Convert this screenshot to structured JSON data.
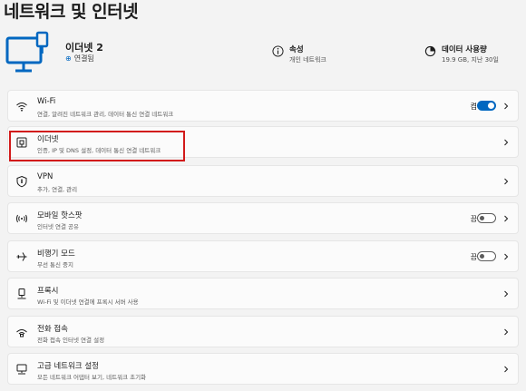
{
  "page": {
    "title": "네트워크 및 인터넷"
  },
  "device": {
    "name": "이더넷 2",
    "status": "연결됨"
  },
  "props": {
    "properties": {
      "label": "속성",
      "sub": "개인 네트워크"
    },
    "usage": {
      "label": "데이터 사용량",
      "sub": "19.9 GB, 지난 30일"
    }
  },
  "items": [
    {
      "title": "Wi-Fi",
      "sub": "연결, 알려진 네트워크 관리, 데이터 통신 연결 네트워크",
      "toggle_label": "켬",
      "toggle": "on",
      "icon": "wifi-icon"
    },
    {
      "title": "이더넷",
      "sub": "인증, IP 및 DNS 설정, 데이터 통신 연결 네트워크",
      "icon": "ethernet-icon"
    },
    {
      "title": "VPN",
      "sub": "추가, 연결, 관리",
      "icon": "vpn-shield-icon"
    },
    {
      "title": "모바일 핫스팟",
      "sub": "인터넷 연결 공유",
      "toggle_label": "끔",
      "toggle": "off",
      "icon": "hotspot-icon"
    },
    {
      "title": "비행기 모드",
      "sub": "무선 통신 중지",
      "toggle_label": "끔",
      "toggle": "off",
      "icon": "airplane-icon"
    },
    {
      "title": "프록시",
      "sub": "Wi-Fi 및 이더넷 연결에 프록시 서버 사용",
      "icon": "proxy-icon"
    },
    {
      "title": "전화 접속",
      "sub": "전화 접속 인터넷 연결 설정",
      "icon": "dialup-icon"
    },
    {
      "title": "고급 네트워크 설정",
      "sub": "모든 네트워크 어댑터 보기, 네트워크 초기화",
      "icon": "advanced-network-icon"
    }
  ],
  "colors": {
    "accent": "#0067c0",
    "highlight": "#d21a1a",
    "background": "#f3f3f3"
  }
}
